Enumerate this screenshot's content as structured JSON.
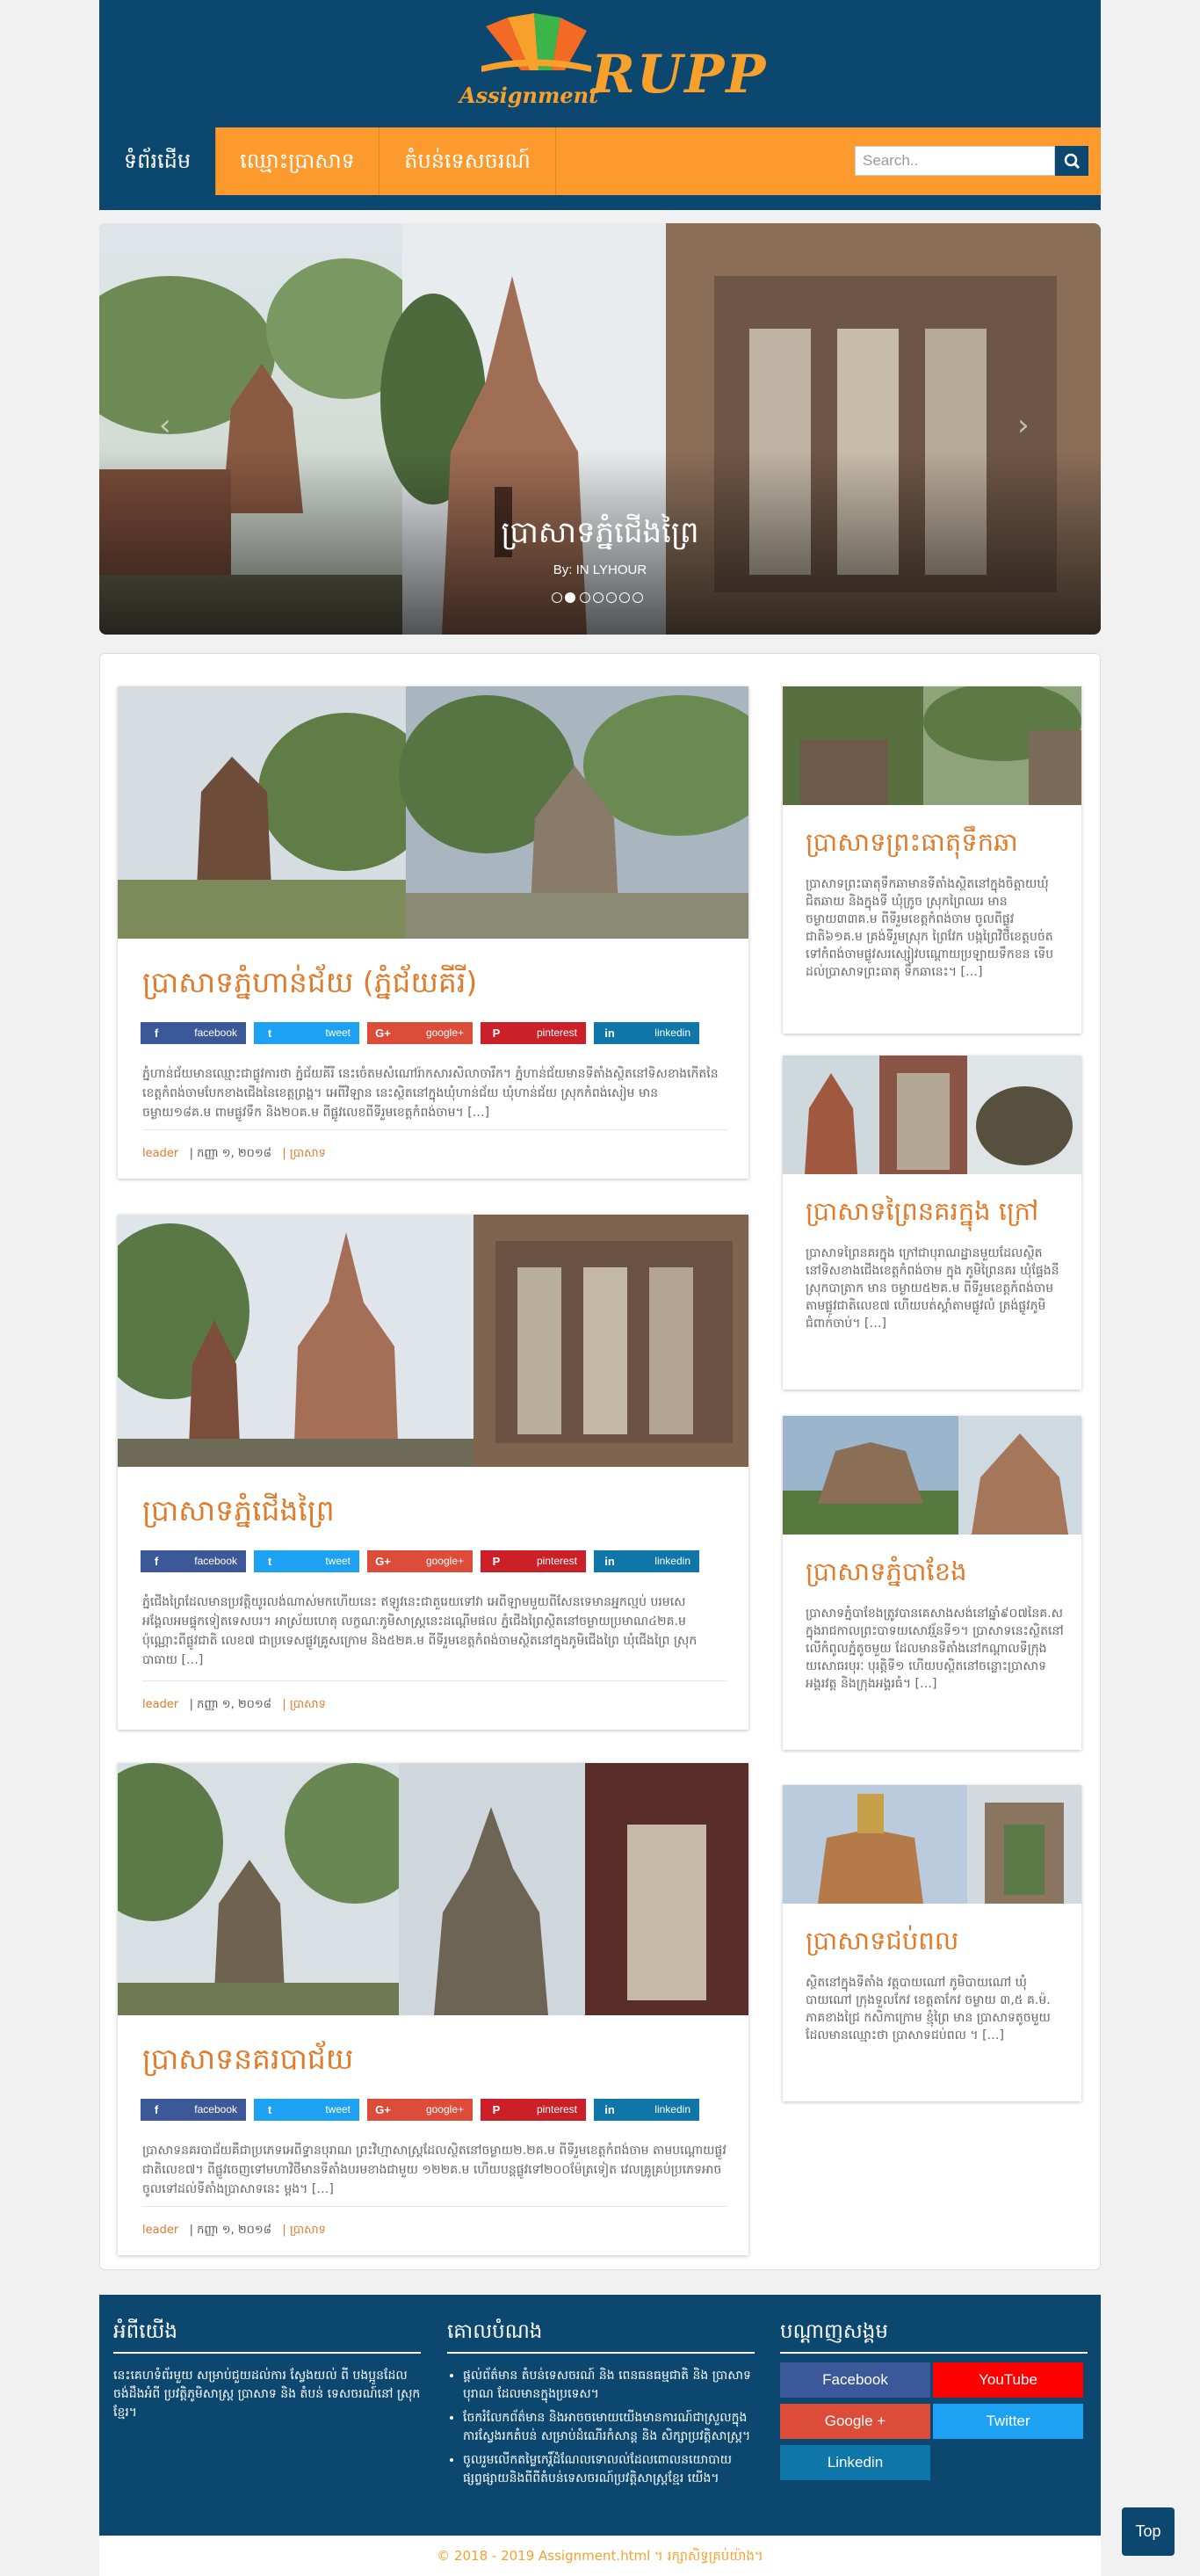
{
  "header": {
    "logo_assignment": "Assignment",
    "logo_rupp": "RUPP"
  },
  "nav": {
    "items": [
      {
        "label": "ទំព័រដើម",
        "active": true
      },
      {
        "label": "ឈ្មោះប្រាសាទ",
        "active": false
      },
      {
        "label": "តំបន់ទេសចរណ៍",
        "active": false
      }
    ],
    "search_placeholder": "Search.."
  },
  "slider": {
    "title": "ប្រាសាទភ្នំជើងព្រៃ",
    "byline": "By: IN LYHOUR",
    "dots": 7,
    "active_dot": 2
  },
  "posts": [
    {
      "title": "ប្រាសាទភ្នំហាន់ជ័យ (ភ្នំជ័យគីរី)",
      "excerpt": "ភ្នំហាន់ជ័យមានឈ្មោះជាផ្លូវការថា ភ្នំជ័យគីរី នេះចេំតមសំណៅរ៉ាកសារសិលាចារឹក។ ភ្នំហាន់ជ័យមានទីតាំងស្ថិតនៅទិសខាងកើតនៃខេត្តកំពង់ចាមបែកខាងជើងនៃខេត្តព្រង្គ។ អេពីវិឡាន នេះស្ថិតនៅក្នុងឃុំហាន់ជ័យ ឃុំហាន់ជ័យ ស្រុកកំពង់សៀម មានចម្ងាយ១៨គ.ម ពាមផ្លូវទឹក និង២០គ.ម ពីផ្លូវលេខពីទីរួមខេត្តកំពង់ចាម។ […]",
      "author": "leader",
      "date": "| កញ្ញា ១, ២០១៨",
      "category": "| ប្រាសាទ"
    },
    {
      "title": "ប្រាសាទភ្នំជើងព្រៃ",
      "excerpt": "ភ្នំជើងព្រៃដែលមានប្រវត្តិយូរលង់ណាស់មកហើយនេះ ឥឡូវនេះជាតួរេយទៅវា អេពីឡាមមួយពីសែនទេមានអ្នកល្មប់ បរមសេអង្គែលអមផ្ទុកទៀតទេសបរ។ អាស្រ័យហេតុ លក្ខណៈភូមិសាស្ត្រនេះដណ្តើមផល ភ្នំជើងព្រៃស្ថិតនៅចម្ងាយប្រមាណ៤២គ.ម ប៉ុណ្ណោះពីផ្លូវជាតិ លេខ៧ ជាប្រទេសផ្លូវគ្រូសក្រោម និង៥២គ.ម ពីទីរួមខេត្តកំពង់ចាមស្ថិតនៅក្នុងភូមិជើងព្រៃ ឃុំជើងព្រៃ ស្រុកបាធាយ […]",
      "author": "leader",
      "date": "| កញ្ញា ១, ២០១៨",
      "category": "| ប្រាសាទ"
    },
    {
      "title": "ប្រាសាទនគរបាជ័យ",
      "excerpt": "ប្រាសាទនគរបាជ័យគឺជាប្រភេទអេពីទ្ធានបុរាណ ព្រះវិហ្មាសាស្ត្រដែលស្ថិតនៅចម្ងាយ២.២គ.ម ពីទីរួមខេត្តកំពង់ចាម តាមបណ្ដោយផ្លូវជាតិលេខ៧។ ពីផ្លូវចេញទៅមហាវិថីមានទីតាំងបរមខាងជាមួយ ១២២គ.ម ហើយបន្តផ្លូវទៅ២០០ម៉ែត្រទៀត វេលគ្រូគ្រប់ប្រភេទអាចចូលទៅដល់ទីតាំងប្រាសាទនេះ ម្តង។ […]",
      "author": "leader",
      "date": "| កញ្ញា ១, ២០១៨",
      "category": "| ប្រាសាទ"
    }
  ],
  "share_buttons": [
    {
      "icon": "f",
      "label": "facebook"
    },
    {
      "icon": "t",
      "label": "tweet"
    },
    {
      "icon": "G+",
      "label": "google+"
    },
    {
      "icon": "P",
      "label": "pinterest"
    },
    {
      "icon": "in",
      "label": "linkedin"
    }
  ],
  "sidebar": [
    {
      "title": "ប្រាសាទព្រះធាតុទឹកឆា",
      "excerpt": "ប្រាសាទព្រះធាតុទឹកឆាមានទីតាំងស្ថិតនៅក្នុងចិត្តាយឃុំជិតឆាយ និងក្នុងទី ឃុំក្រូច ស្រុកព្រៃឈរ មាន ចម្ងាយ៣៣គ.ម ពីទីរួមខេត្តកំពង់ចាម ចូលពីផ្លូវជាតិ៦១គ.ម គ្រង់ទីរួមស្រុក ព្រៃវែក បង្កព្រៃវិថីខេត្តបច់តទៅកំពង់ចាមផ្លូវសរស្សៀវបណ្តោយប្រឡាយទឹកខន ទើបដល់ប្រាសាទព្រះធាតុ ទឹកឆានេះ។ […]"
    },
    {
      "title": "ប្រាសាទព្រៃនគរក្នុង ក្រៅ",
      "excerpt": "ប្រាសាទព្រៃនគរក្នុង ក្រៅជាបុរាណដ្ឋានមួយដែលស្ថិតនៅទិសខាងជើងខេត្តកំពង់ចាម ក្នុង ភូមិព្រៃនគរ ឃុំផ្ទែងនី ស្រុកបាត្រាក មាន ចម្ងាយ៥២គ.ម ពីទីរួមខេត្តកំពង់ចាមតាមផ្លូវជាតិលេខ៧ ហើយបត់ស្តាំតាមផ្លូវលំ ត្រង់ផ្លូវភូមិ ជំពាក់ចាប់។ […]"
    },
    {
      "title": "ប្រាសាទភ្នំបាខែង",
      "excerpt": "ប្រាសាទភ្នំបាខែងត្រូវបានគេសាងសង់នៅឆ្នាំ៩០៧នៃគ.ស ក្នុងរាជកាលព្រះបាទយសោវរ្ម័នទី១។ ប្រាសាទនេះស្ថិតនៅលើកំពូលភ្នំតូចមួយ ដែលមានទីតាំងនៅកណ្តាលទីក្រុងយសោធរបុរៈ បុរត្តិទី១ ហើយបស្ថិតនៅចន្លោះប្រាសាទអង្គរវត្ត និងក្រុងអង្គរធំ។ […]"
    },
    {
      "title": "ប្រាសាទជប់ពល",
      "excerpt": "ស្ថិតនៅក្នុងទីតាំង វត្តបាយណៅ ភូមិបាយណៅ ឃុំបាយណៅ ក្រុងទួលកែវ ខេត្តតាកែវ ចម្ងាយ ៣,៥ គ.ម៉. ភាគខាងជ្រៃ កសិកាក្រោម ខ្មុំព្រៃ មាន ប្រាសាទតូចមួយដែលមានឈ្មោះថា ប្រាសាទជប់ពល ។ […]"
    }
  ],
  "footer": {
    "about": {
      "heading": "អំពីយើង",
      "text": "នេះគេហទំព័រមួយ សម្រាប់ជួយដល់ការ ស្វែងយល់ ពី បងប្អូនដែលចង់ដឹងអំពី ប្រវត្តិភូមិសាស្ត្រ ប្រាសាទ និង តំបន់ ទេសចរណ៍នៅ ស្រុកខ្មែរ។"
    },
    "goal": {
      "heading": "គោលបំណង",
      "items": [
        "ផ្តល់ព័ត៌មាន តំបន់ទេសចរណ៍ និង ពេនធនធម្មជាតិ និង ប្រាសាទបុរាណ ដែលមានក្នុងប្រទេស។",
        "ចែករំលែកព័ត៌មាន និងអាចចមោយយើងមានការណ៍ជាស្រួលក្នុងការស្វែងរកតំបន់ សម្រាប់ដំណើរកំសាន្ត និង សិក្សាប្រវត្តិសាស្ត្រ។",
        "ចូលរួមលើកតម្លៃកេរ្តិ៍ដំណែលទោលល់ដែលពោលនយោបាយផ្សព្វផ្សាយនិងពីពីតំបន់ទេសចរណ៍ប្រវត្តិសាស្ត្រខ្មែរ យើង។"
      ]
    },
    "social": {
      "heading": "បណ្ដាញសង្គម",
      "buttons": [
        {
          "label": "Facebook",
          "color": "#3b5998"
        },
        {
          "label": "YouTube",
          "color": "#ff0000"
        },
        {
          "label": "Google +",
          "color": "#dd4b39"
        },
        {
          "label": "Twitter",
          "color": "#1da1f2"
        },
        {
          "label": "Linkedin",
          "color": "#0e76a8"
        }
      ]
    },
    "copyright": "© 2018 - 2019 Assignment.html ។ រក្សាសិទ្ធគ្រប់យ៉ាង។"
  },
  "top_button": "Top",
  "colors": {
    "primary": "#0c476f",
    "accent": "#fd9a2d",
    "title_orange": "#e07b2c"
  }
}
